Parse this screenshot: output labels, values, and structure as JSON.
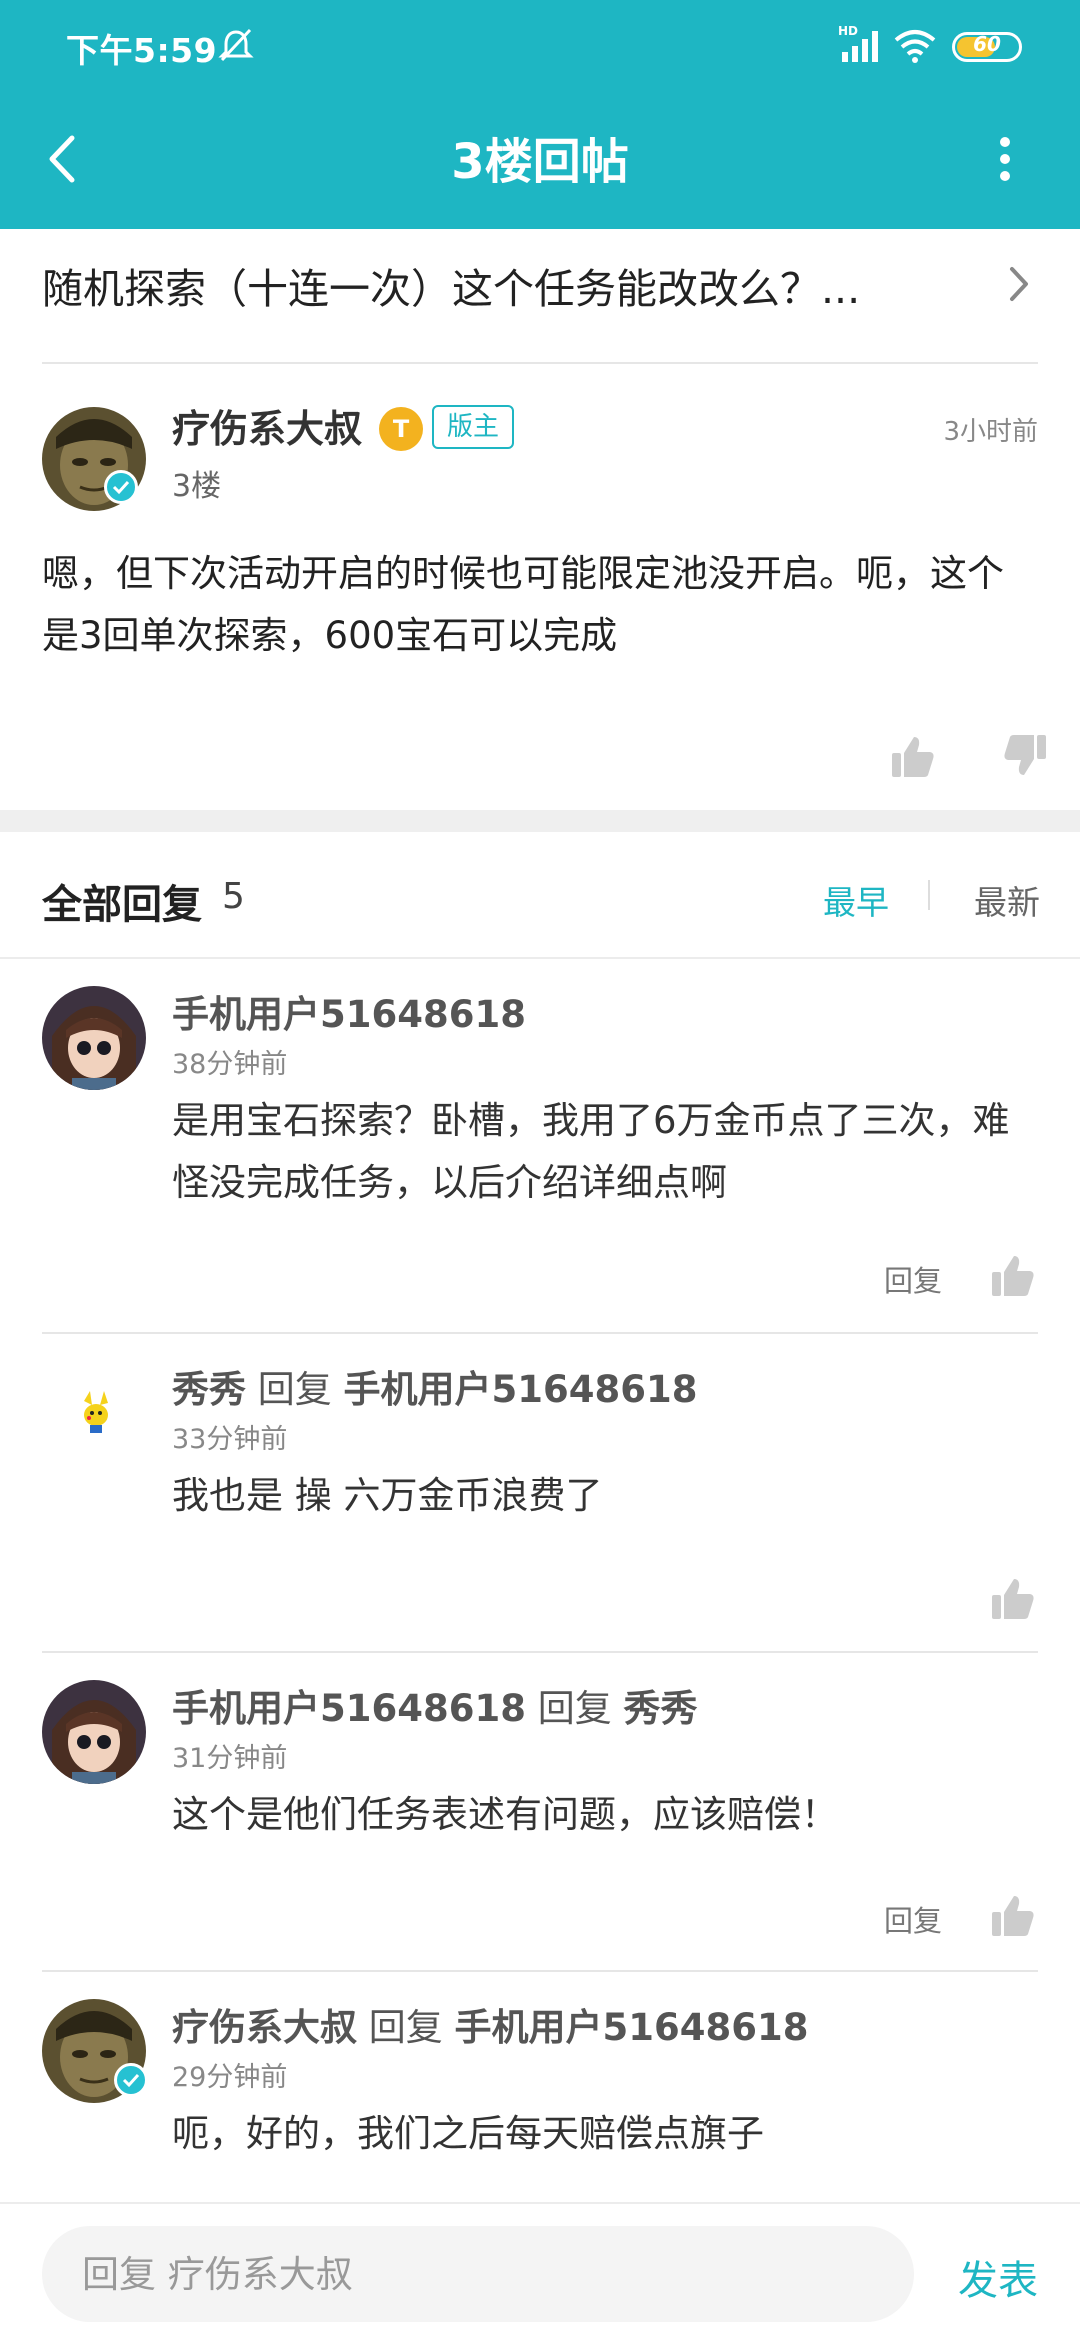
{
  "status_bar": {
    "time": "下午5:59",
    "network": "HD",
    "battery": "60"
  },
  "header": {
    "title": "3楼回帖"
  },
  "thread": {
    "title": "随机探索（十连一次）这个任务能改改么？..."
  },
  "post": {
    "author": "疗伤系大叔",
    "medal": "T",
    "badge": "版主",
    "floor": "3楼",
    "time": "3小时前",
    "content": "嗯，但下次活动开启的时候也可能限定池没开启。呃，这个是3回单次探索，600宝石可以完成"
  },
  "replies_header": {
    "label": "全部回复",
    "count": "5",
    "sort_earliest": "最早",
    "sort_latest": "最新"
  },
  "replies": [
    {
      "author": "手机用户51648618",
      "reply_word": "",
      "target": "",
      "time": "38分钟前",
      "text": "是用宝石探索？卧槽，我用了6万金币点了三次，难怪没完成任务，以后介绍详细点啊",
      "reply_label": "回复"
    },
    {
      "author": "秀秀",
      "reply_word": "回复",
      "target": "手机用户51648618",
      "time": "33分钟前",
      "text": "我也是 操 六万金币浪费了",
      "reply_label": ""
    },
    {
      "author": "手机用户51648618",
      "reply_word": "回复",
      "target": "秀秀",
      "time": "31分钟前",
      "text": "这个是他们任务表述有问题，应该赔偿！",
      "reply_label": "回复"
    },
    {
      "author": "疗伤系大叔",
      "reply_word": "回复",
      "target": "手机用户51648618",
      "time": "29分钟前",
      "text": "呃，好的，我们之后每天赔偿点旗子",
      "reply_label": ""
    }
  ],
  "composer": {
    "placeholder": "回复 疗伤系大叔",
    "send_label": "发表"
  },
  "colors": {
    "accent": "#1eb6c3",
    "medal": "#f3b21f"
  },
  "icons": [
    "back-arrow-icon",
    "more-vert-icon",
    "chevron-right-icon",
    "thumbs-up-icon",
    "thumbs-down-icon",
    "verified-icon",
    "mute-bell-icon",
    "signal-icon",
    "wifi-icon",
    "battery-icon"
  ]
}
